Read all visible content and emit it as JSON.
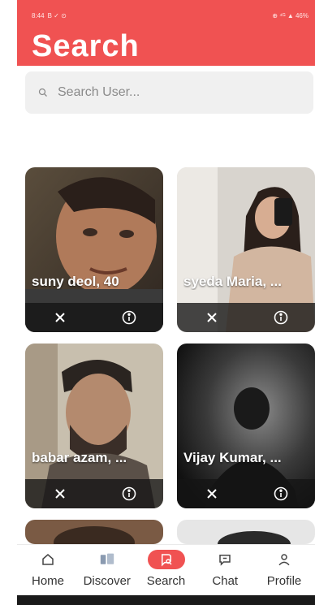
{
  "status": {
    "time": "8:44",
    "left_icons": "B ✓ ⊙",
    "right_text": "⊕ ⁴ᴳ ▲ 46%"
  },
  "header": {
    "title": "Search"
  },
  "search": {
    "placeholder": "Search User..."
  },
  "cards": [
    {
      "name": "suny deol, 40"
    },
    {
      "name": "syeda Maria, ..."
    },
    {
      "name": "babar azam, ..."
    },
    {
      "name": "Vijay Kumar, ..."
    }
  ],
  "nav": {
    "items": [
      {
        "label": "Home",
        "icon": "home-icon"
      },
      {
        "label": "Discover",
        "icon": "discover-icon"
      },
      {
        "label": "Search",
        "icon": "search-icon"
      },
      {
        "label": "Chat",
        "icon": "chat-icon"
      },
      {
        "label": "Profile",
        "icon": "profile-icon"
      }
    ]
  },
  "colors": {
    "accent": "#f05252",
    "search_bg": "#f0f0f0"
  }
}
